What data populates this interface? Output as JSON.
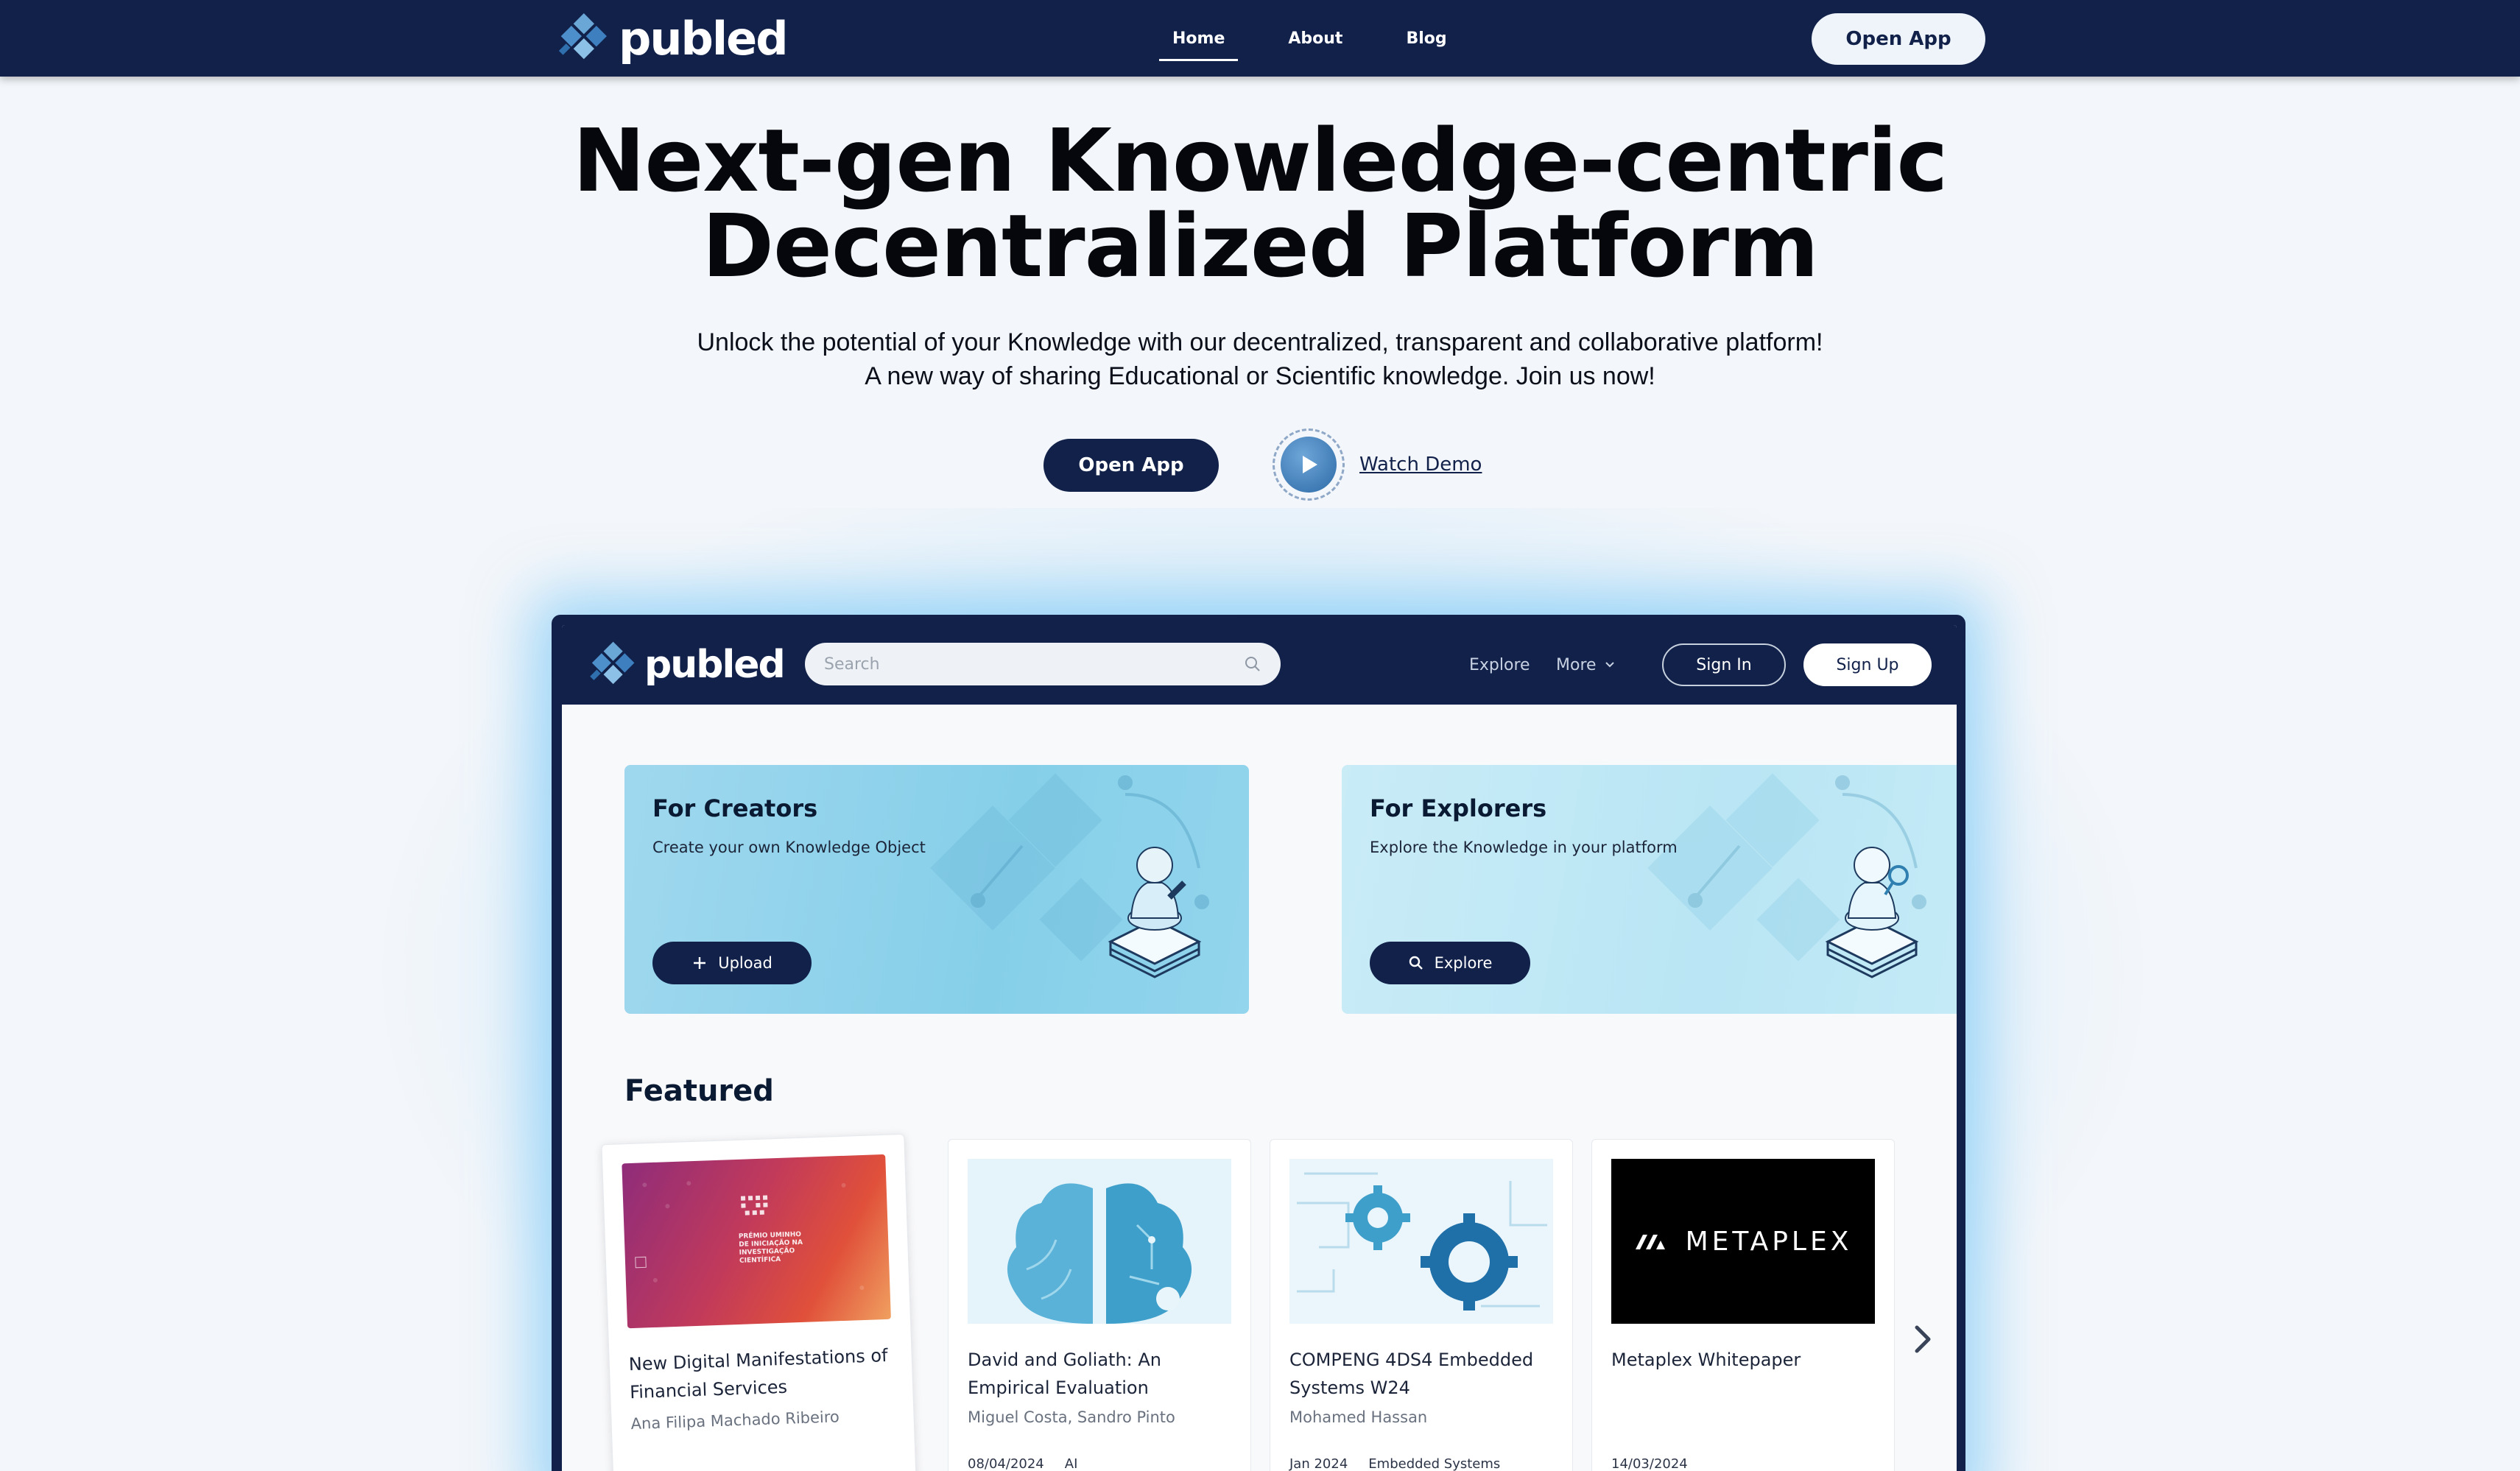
{
  "topnav": {
    "brand": "publed",
    "links": [
      {
        "label": "Home",
        "active": true
      },
      {
        "label": "About",
        "active": false
      },
      {
        "label": "Blog",
        "active": false
      }
    ],
    "cta": "Open App"
  },
  "hero": {
    "title_line1": "Next-gen Knowledge-centric",
    "title_line2": "Decentralized Platform",
    "subtitle_line1": "Unlock the potential of your Knowledge with our decentralized, transparent and collaborative platform!",
    "subtitle_line2": "A new way of sharing Educational or Scientific knowledge. Join us now!",
    "cta": "Open App",
    "demo_label": "Watch Demo"
  },
  "app": {
    "brand": "publed",
    "search_placeholder": "Search",
    "nav": {
      "explore": "Explore",
      "more": "More"
    },
    "sign_in": "Sign In",
    "sign_up": "Sign Up",
    "promos": [
      {
        "title": "For Creators",
        "description": "Create your own Knowledge Object",
        "button": "Upload",
        "icon": "plus-icon"
      },
      {
        "title": "For Explorers",
        "description": "Explore the Knowledge in your platform",
        "button": "Explore",
        "icon": "search-icon"
      }
    ],
    "featured_title": "Featured",
    "featured": [
      {
        "title": "New Digital Manifestations of Financial Services",
        "author": "Ana Filipa Machado Ribeiro",
        "date": "",
        "tag": "",
        "thumb_text": "PRÉMIO UMINHO DE INICIAÇÃO NA INVESTIGAÇÃO CIENTÍFICA"
      },
      {
        "title": "David and Goliath: An Empirical Evaluation",
        "author": "Miguel Costa, Sandro Pinto",
        "date": "08/04/2024",
        "tag": "AI"
      },
      {
        "title": "COMPENG 4DS4 Embedded Systems W24",
        "author": "Mohamed Hassan",
        "date": "Jan 2024",
        "tag": "Embedded Systems"
      },
      {
        "title": "Metaplex Whitepaper",
        "author": "",
        "date": "14/03/2024",
        "tag": "",
        "thumb_text": "METAPLEX"
      }
    ]
  },
  "colors": {
    "navy": "#11214a",
    "glow": "#5fbef5",
    "creators_card": "#86cfe9",
    "explorers_card": "#c4eaf6"
  }
}
